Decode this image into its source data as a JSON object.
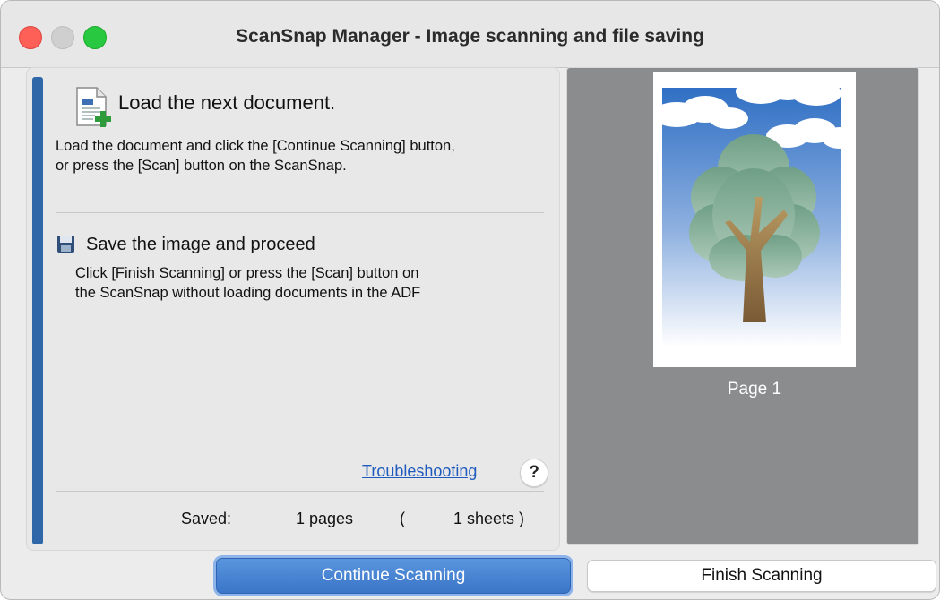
{
  "window": {
    "title": "ScanSnap Manager - Image scanning and file saving"
  },
  "steps": {
    "load": {
      "heading": "Load the next document.",
      "text": "Load the document and click the [Continue Scanning] button,\nor press the [Scan] button on the ScanSnap."
    },
    "save": {
      "heading": "Save the image and proceed",
      "text": "Click [Finish Scanning] or press the [Scan] button on\nthe ScanSnap without loading documents in the ADF"
    }
  },
  "help": {
    "troubleshooting_label": "Troubleshooting",
    "help_label": "?"
  },
  "status": {
    "saved_label": "Saved:",
    "pages": "1 pages",
    "paren_open": "(",
    "sheets": "1 sheets )"
  },
  "preview": {
    "page_label": "Page 1"
  },
  "buttons": {
    "continue_label": "Continue Scanning",
    "finish_label": "Finish Scanning"
  },
  "icons": {
    "close": "close-icon",
    "minimize": "minimize-icon",
    "zoom": "zoom-icon",
    "document_add": "document-add-icon",
    "save": "floppy-disk-icon",
    "help": "help-icon"
  },
  "colors": {
    "accent": "#2f67a8",
    "primary_button": "#3a75c8",
    "link": "#1f5bbd",
    "preview_bg": "#8a8c8e"
  }
}
